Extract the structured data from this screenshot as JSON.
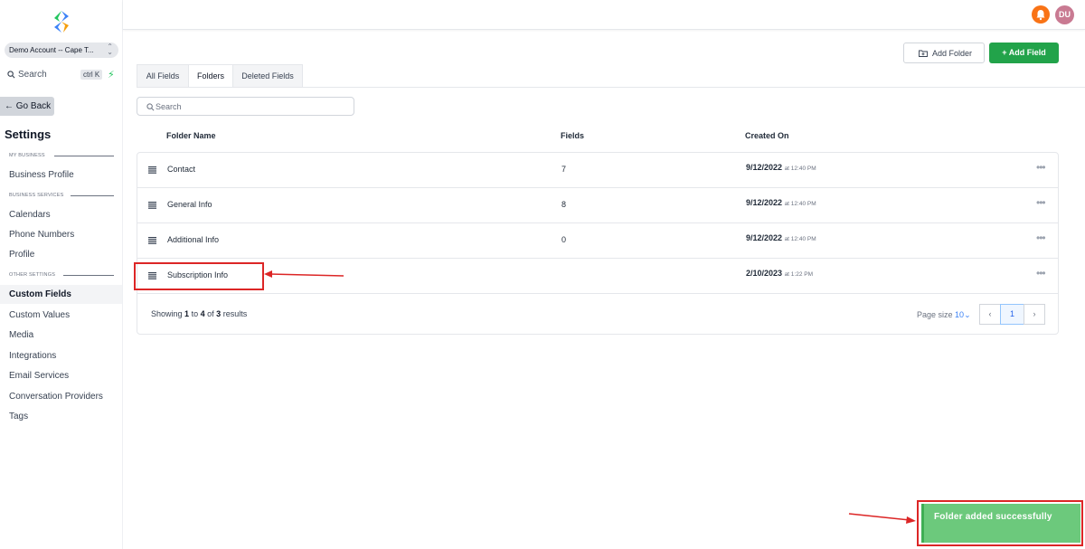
{
  "sidebar": {
    "account": "Demo Account -- Cape T...",
    "search_label": "Search",
    "search_shortcut": "ctrl K",
    "go_back": "Go Back",
    "settings_title": "Settings",
    "sections": {
      "my_business": "MY BUSINESS",
      "business_services": "BUSINESS SERVICES",
      "other_settings": "OTHER SETTINGS"
    },
    "items": [
      {
        "label": "Business Profile"
      },
      {
        "label": "Calendars"
      },
      {
        "label": "Phone Numbers"
      },
      {
        "label": "Profile"
      },
      {
        "label": "Custom Fields"
      },
      {
        "label": "Custom Values"
      },
      {
        "label": "Media"
      },
      {
        "label": "Integrations"
      },
      {
        "label": "Email Services"
      },
      {
        "label": "Conversation Providers"
      },
      {
        "label": "Tags"
      }
    ],
    "active_item": "Custom Fields"
  },
  "header": {
    "avatar_initials": "DU",
    "notification_color": "#f97316"
  },
  "toolbar": {
    "add_folder_label": "Add Folder",
    "add_field_label": "+ Add Field"
  },
  "tabs": [
    {
      "label": "All Fields"
    },
    {
      "label": "Folders"
    },
    {
      "label": "Deleted Fields"
    }
  ],
  "active_tab": "Folders",
  "search": {
    "placeholder": "Search"
  },
  "table": {
    "columns": [
      "Folder Name",
      "Fields",
      "Created On"
    ],
    "rows": [
      {
        "name": "Contact",
        "fields": "7",
        "date": "9/12/2022",
        "time": "at 12:40 PM"
      },
      {
        "name": "General Info",
        "fields": "8",
        "date": "9/12/2022",
        "time": "at 12:40 PM"
      },
      {
        "name": "Additional Info",
        "fields": "0",
        "date": "9/12/2022",
        "time": "at 12:40 PM"
      },
      {
        "name": "Subscription Info",
        "fields": "",
        "date": "2/10/2023",
        "time": "at 1:22 PM"
      }
    ]
  },
  "pagination": {
    "showing_prefix": "Showing",
    "from": "1",
    "to_word": "to",
    "to": "4",
    "of_word": "of",
    "total": "3",
    "results_word": "results",
    "page_size_label": "Page size",
    "page_size_value": "10",
    "current_page": "1"
  },
  "toast": {
    "message": "Folder added successfully",
    "color": "#6cc97c"
  },
  "accent_colors": {
    "primary_green": "#22a34a",
    "annotation_red": "#dc2626"
  }
}
